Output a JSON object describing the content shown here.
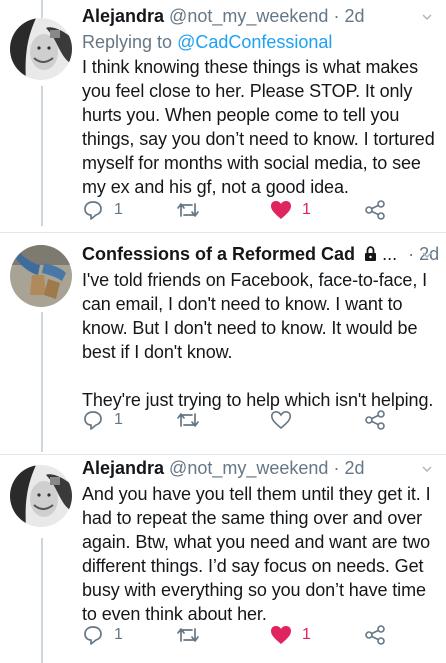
{
  "tweets": [
    {
      "author_name": "Alejandra",
      "author_handle": "@not_my_weekend",
      "sep": "·",
      "time": "2d",
      "reply_prefix": "Replying to",
      "reply_to": "@CadConfessional",
      "text": "I think knowing these things is what makes you feel close to her. Please STOP. It only hurts you. When people come to tell you things, say you don’t need to know. I tortured myself for months with social media, to see my ex and his gf, not a good idea.",
      "reply_count": "1",
      "retweet_count": "",
      "like_count": "1",
      "liked": true
    },
    {
      "author_name": "Confessions of a Reformed Cad",
      "ellipsis": "...",
      "sep": "·",
      "time": "2d",
      "protected_icon": "lock-icon",
      "text": "I've told friends on Facebook, face-to-face, I can email, I don't need to know. I want to know. But I don't need to know. It would be best if I don't know.\n\nThey're just trying to help which isn't helping.",
      "reply_count": "1",
      "retweet_count": "",
      "like_count": "",
      "liked": false
    },
    {
      "author_name": "Alejandra",
      "author_handle": "@not_my_weekend",
      "sep": "·",
      "time": "2d",
      "text": "And you have you tell them until they get it. I had to repeat the same thing over and over again. Btw, what you need and want are two different things. I’d say focus on needs. Get busy with everything so you don’t have time to even think about her.",
      "reply_count": "1",
      "retweet_count": "",
      "like_count": "1",
      "liked": true
    }
  ],
  "colors": {
    "text": "#14171a",
    "secondary": "#657786",
    "link": "#1da1f2",
    "like": "#e0245e",
    "divider": "#e1e8ed",
    "thread_line": "#ccd6dd"
  }
}
